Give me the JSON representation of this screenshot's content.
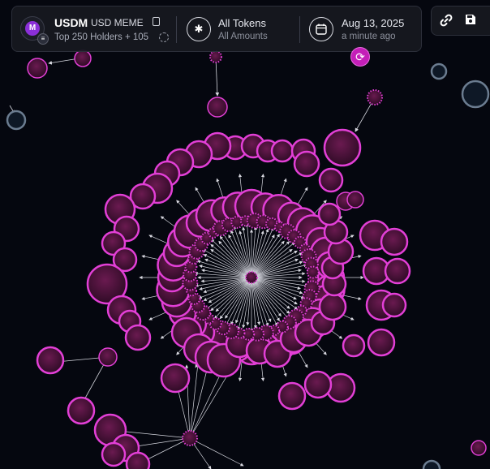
{
  "token": {
    "avatar_letter": "M",
    "symbol": "USDM",
    "name": "USD MEME",
    "holders_text": "Top 250 Holders + 105"
  },
  "filter": {
    "title": "All Tokens",
    "subtitle": "All Amounts",
    "icon": "asterisk-icon"
  },
  "date": {
    "value": "Aug 13, 2025",
    "relative": "a minute ago",
    "icon": "calendar-icon"
  },
  "tools": {
    "link_icon": "link-icon",
    "save_icon": "save-icon",
    "refresh_icon": "refresh-icon"
  },
  "colors": {
    "accent": "#e23fd6",
    "node_fill": "#4a1236",
    "panel": "#16181f",
    "background": "#05070f"
  }
}
